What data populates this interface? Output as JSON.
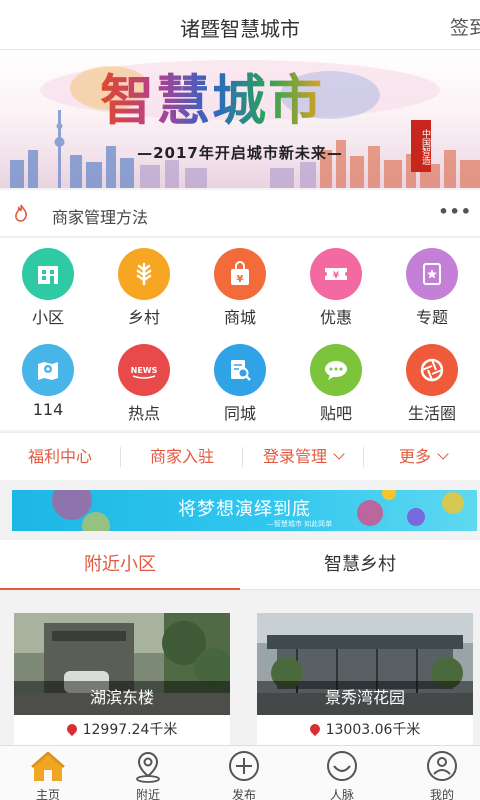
{
  "header": {
    "title": "诸暨智慧城市",
    "signin": "签到"
  },
  "banner": {
    "title": "智慧城市",
    "seal": "中国智造",
    "slogan": "—2017年开启城市新未来—"
  },
  "notice": {
    "text": "商家管理方法",
    "more": "•••"
  },
  "grid": [
    {
      "label": "小区",
      "icon": "building-icon",
      "color": "#2fc9a4"
    },
    {
      "label": "乡村",
      "icon": "wheat-icon",
      "color": "#f6a623"
    },
    {
      "label": "商城",
      "icon": "shopping-bag-icon",
      "color": "#f36b3a"
    },
    {
      "label": "优惠",
      "icon": "coupon-icon",
      "color": "#f36aa3"
    },
    {
      "label": "专题",
      "icon": "star-page-icon",
      "color": "#c47fd6"
    },
    {
      "label": "114",
      "icon": "map-pin-icon",
      "color": "#48b5e8"
    },
    {
      "label": "热点",
      "icon": "news-icon",
      "color": "#e84a4a"
    },
    {
      "label": "同城",
      "icon": "doc-search-icon",
      "color": "#2fa3e6"
    },
    {
      "label": "贴吧",
      "icon": "chat-bubble-icon",
      "color": "#7bc43b"
    },
    {
      "label": "生活圈",
      "icon": "aperture-icon",
      "color": "#ef5a3a"
    }
  ],
  "links": {
    "welfare": "福利中心",
    "merchant": "商家入驻",
    "login": "登录管理",
    "more": "更多"
  },
  "ad": {
    "main": "将梦想演绎到底",
    "sub": "—智慧城市  如此简单"
  },
  "sections": {
    "nearby": "附近小区",
    "village": "智慧乡村"
  },
  "cards": [
    {
      "name": "湖滨东楼",
      "distance": "12997.24千米"
    },
    {
      "name": "景秀湾花园",
      "distance": "13003.06千米"
    }
  ],
  "nav": [
    {
      "label": "主页",
      "icon": "home-icon"
    },
    {
      "label": "附近",
      "icon": "location-icon"
    },
    {
      "label": "发布",
      "icon": "plus-circle-icon"
    },
    {
      "label": "人脉",
      "icon": "smile-icon"
    },
    {
      "label": "我的",
      "icon": "user-icon"
    }
  ],
  "colors": {
    "accent": "#e2593f",
    "home_icon": "#f0a623"
  }
}
